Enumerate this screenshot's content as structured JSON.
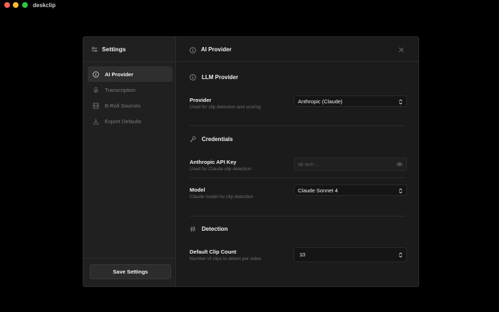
{
  "window": {
    "app_title": "deskclip"
  },
  "sidebar": {
    "title": "Settings",
    "items": [
      {
        "label": "AI Provider",
        "icon": "info-icon",
        "active": true
      },
      {
        "label": "Transcription",
        "icon": "microphone-icon",
        "active": false
      },
      {
        "label": "B-Roll Sources",
        "icon": "film-icon",
        "active": false
      },
      {
        "label": "Export Defaults",
        "icon": "download-icon",
        "active": false
      }
    ],
    "save_label": "Save Settings"
  },
  "main": {
    "header_title": "AI Provider",
    "sections": {
      "llm": {
        "title": "LLM Provider",
        "provider": {
          "label": "Provider",
          "help": "Used for clip detection and scoring",
          "value": "Anthropic (Claude)"
        }
      },
      "credentials": {
        "title": "Credentials",
        "api_key": {
          "label": "Anthropic API Key",
          "help": "Used for Claude clip detection",
          "placeholder": "sk-ant-..."
        },
        "model": {
          "label": "Model",
          "help": "Claude model for clip detection",
          "value": "Claude Sonnet 4"
        }
      },
      "detection": {
        "title": "Detection",
        "clip_count": {
          "label": "Default Clip Count",
          "help": "Number of clips to detect per video",
          "value": "10"
        }
      }
    }
  },
  "colors": {
    "background": "#000000",
    "dialog": "#1b1b1b",
    "sidebar": "#202020",
    "active_item": "#2f2f2f",
    "text_primary": "#f0f0f0",
    "text_muted": "#6f6f6f"
  }
}
